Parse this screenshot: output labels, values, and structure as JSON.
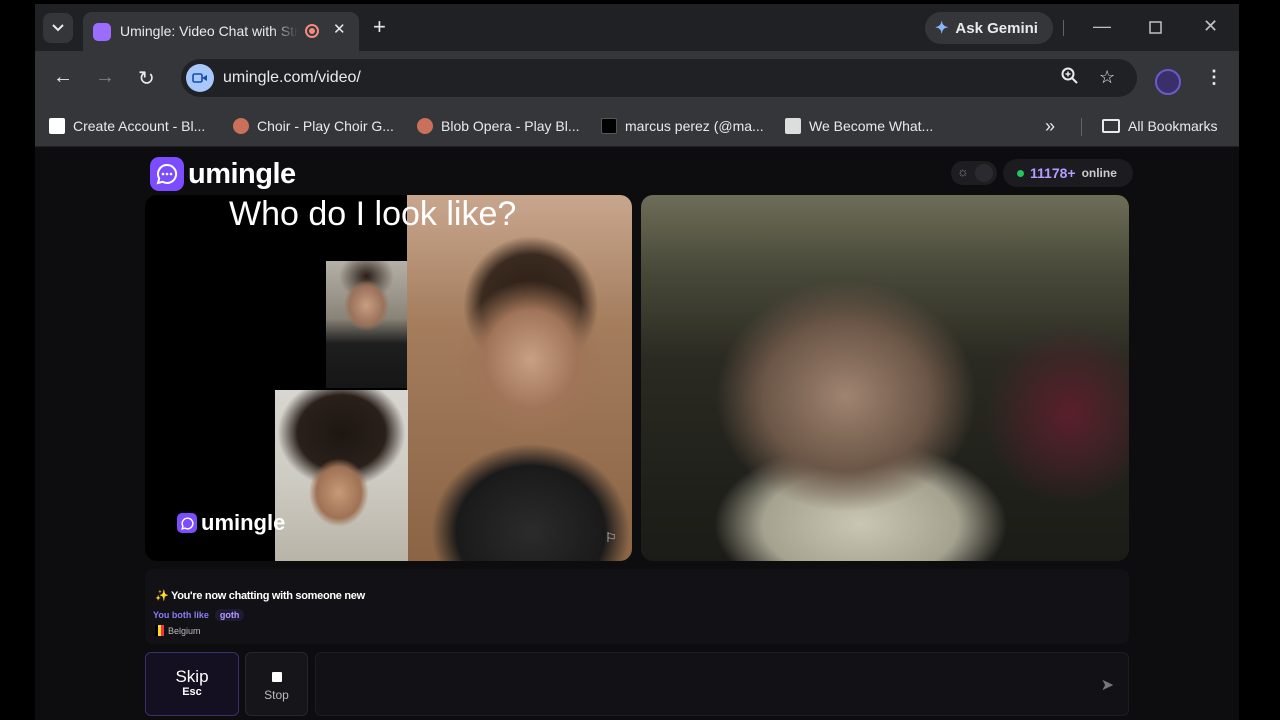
{
  "browser": {
    "tab": {
      "title": "Umingle: Video Chat with Strangers"
    },
    "ask_gemini": "Ask Gemini",
    "url": "umingle.com/video/",
    "bookmarks": [
      {
        "label": "Create Account - Bl...",
        "icon": "account-icon",
        "color": "#ffffff"
      },
      {
        "label": "Choir - Play Choir G...",
        "icon": "choir-icon",
        "color": "#d9534f"
      },
      {
        "label": "Blob Opera - Play Bl...",
        "icon": "blob-opera-icon",
        "color": "#d9534f"
      },
      {
        "label": "marcus perez (@ma...",
        "icon": "tiktok-icon",
        "color": "#000000"
      },
      {
        "label": "We Become What...",
        "icon": "game-icon",
        "color": "#dddddd"
      }
    ],
    "all_bookmarks": "All Bookmarks"
  },
  "page": {
    "logo": "umingle",
    "online_count": "11178+",
    "online_label": "online",
    "remote_caption": "Who do I look like?",
    "watermark": "umingle",
    "chat": {
      "status": "You're now chatting with someone new",
      "interests_prefix": "You both like",
      "interest": "goth",
      "country": "Belgium"
    },
    "skip": {
      "label": "Skip",
      "key": "Esc"
    },
    "stop": {
      "label": "Stop"
    }
  },
  "colors": {
    "brand": "#7c4dff",
    "online_dot": "#22c55e",
    "accent_text": "#b69cff"
  }
}
